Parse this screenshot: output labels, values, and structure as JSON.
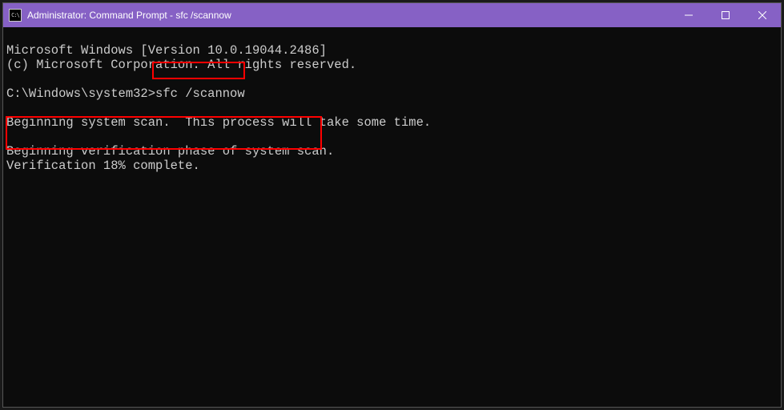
{
  "titlebar": {
    "title": "Administrator: Command Prompt - sfc  /scannow"
  },
  "terminal": {
    "line1": "Microsoft Windows [Version 10.0.19044.2486]",
    "line2": "(c) Microsoft Corporation. All rights reserved.",
    "prompt": "C:\\Windows\\system32>",
    "command": "sfc /scannow",
    "line_scan": "Beginning system scan.  This process will take some time.",
    "line_verify1": "Beginning verification phase of system scan.",
    "line_verify2": "Verification 18% complete."
  }
}
